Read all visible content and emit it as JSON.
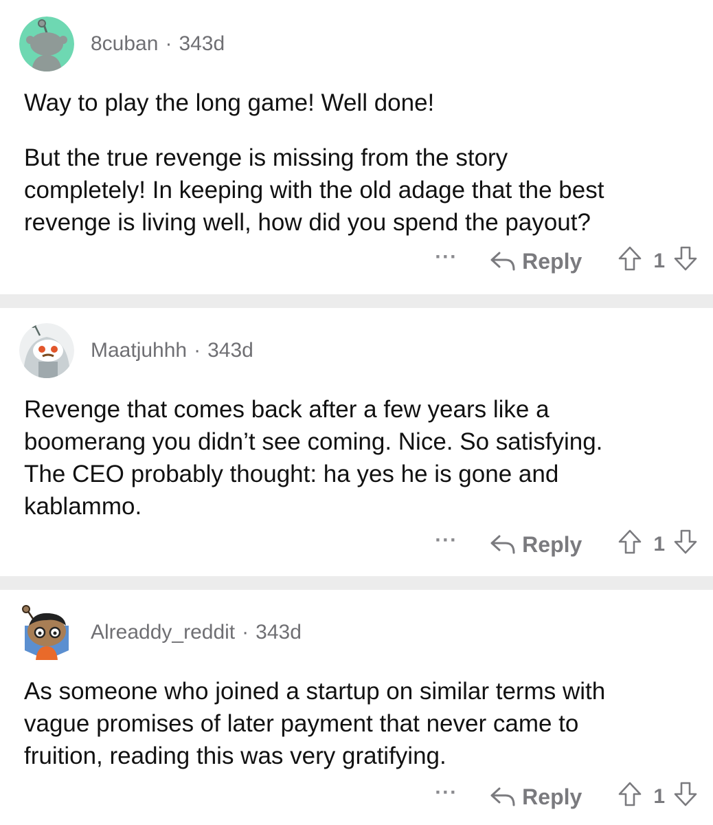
{
  "comments": [
    {
      "username": "8cuban",
      "separator": "·",
      "age": "343d",
      "avatar_icon": "snoo-avatar-mint",
      "paragraphs": [
        "Way to play the long game!  Well done!",
        "But the true revenge is missing from the story\ncompletely!  In keeping with the old adage that the best\nrevenge is living well, how did you spend the payout?"
      ],
      "more_label": "···",
      "reply_label": "Reply",
      "score": "1"
    },
    {
      "username": "Maatjuhhh",
      "separator": "·",
      "age": "343d",
      "avatar_icon": "snoo-avatar-hooded",
      "paragraphs": [
        "Revenge that comes back after a few years like a\nboomerang you didn’t see coming. Nice. So satisfying.\nThe CEO probably thought: ha yes he is gone and\nkablammo."
      ],
      "more_label": "···",
      "reply_label": "Reply",
      "score": "1"
    },
    {
      "username": "Alreaddy_reddit",
      "separator": "·",
      "age": "343d",
      "avatar_icon": "snoo-avatar-glasses",
      "paragraphs": [
        "As someone who joined a startup on similar terms with\nvague promises of later payment that never came to\nfruition, reading this was very gratifying."
      ],
      "more_label": "···",
      "reply_label": "Reply",
      "score": "1"
    }
  ],
  "colors": {
    "meta_text": "#6f6f73",
    "body_text": "#111111",
    "separator": "#ececec",
    "avatar_mint": "#6ed8b2",
    "avatar_hood": "#c9d0d3",
    "avatar_blue": "#5b8fd0"
  }
}
